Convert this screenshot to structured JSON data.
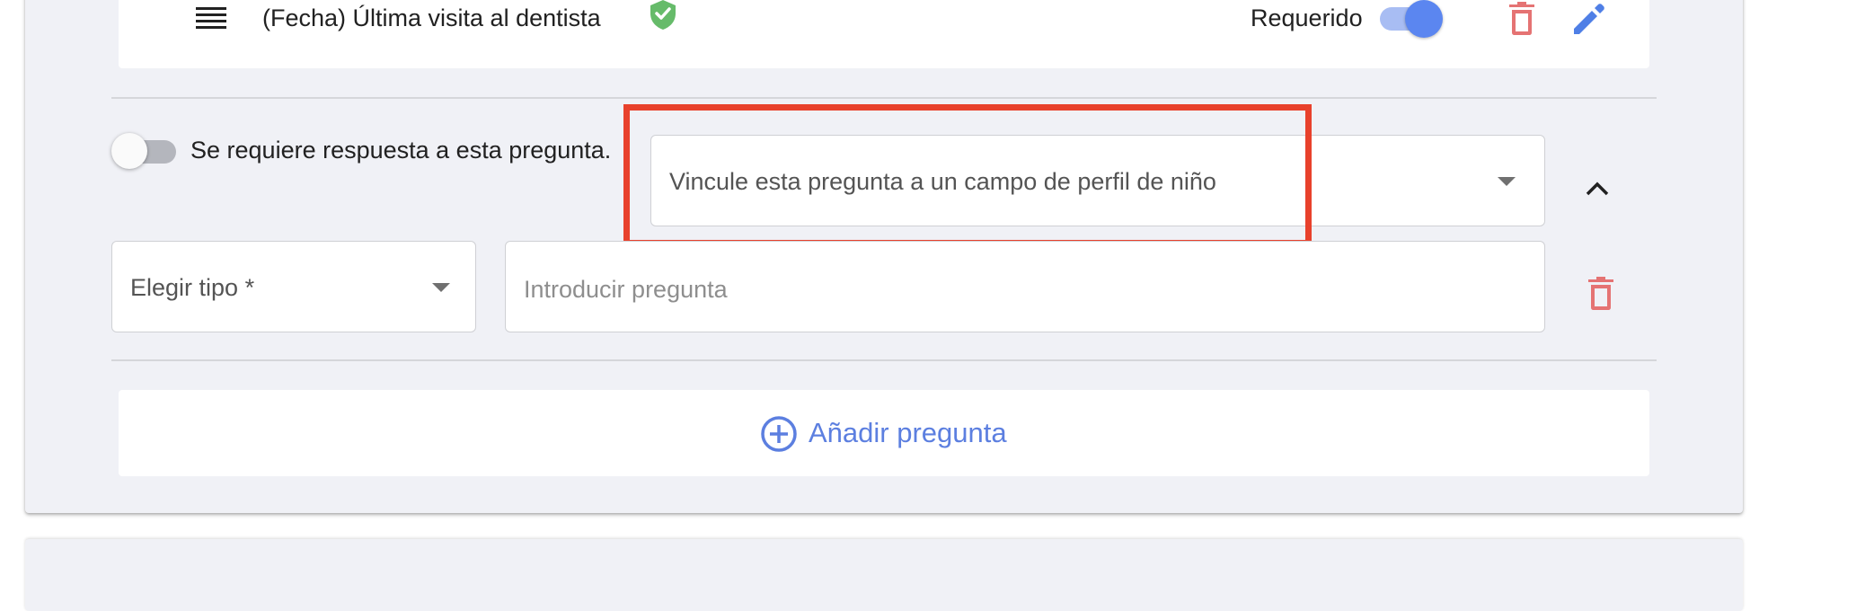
{
  "question": {
    "title": "(Fecha) Última visita al dentista",
    "required_label": "Requerido",
    "required_toggle": "on"
  },
  "editor": {
    "require_answer_label": "Se requiere respuesta a esta pregunta.",
    "require_answer_toggle": "off",
    "link_profile_placeholder": "Vincule esta pregunta a un campo de perfil de niño",
    "type_select_label": "Elegir tipo *",
    "question_input_placeholder": "Introducir pregunta"
  },
  "add_question_label": "Añadir pregunta",
  "icons": {
    "drag": "drag-handle-icon",
    "verified": "shield-check-icon",
    "delete": "trash-icon",
    "edit": "pencil-icon",
    "collapse": "chevron-up-icon",
    "add": "plus-circle-icon"
  },
  "colors": {
    "accent": "#5c7fe0",
    "danger": "#e57373",
    "verified": "#66bb6a",
    "highlight": "#e8412c"
  }
}
